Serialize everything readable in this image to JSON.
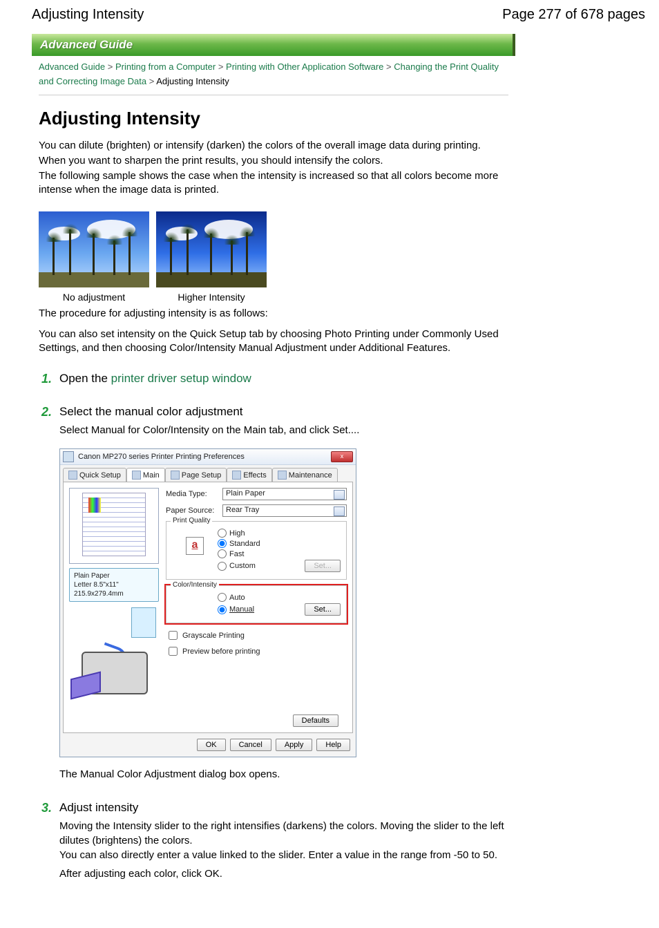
{
  "header": {
    "title": "Adjusting Intensity",
    "page_info": "Page 277 of 678 pages"
  },
  "banner": "Advanced Guide",
  "breadcrumb": {
    "l1": "Advanced Guide",
    "l2": "Printing from a Computer",
    "l3": "Printing with Other Application Software",
    "l4": "Changing the Print Quality and Correcting Image Data",
    "current": "Adjusting Intensity",
    "sep": ">"
  },
  "page_title": "Adjusting Intensity",
  "intro": {
    "p1": "You can dilute (brighten) or intensify (darken) the colors of the overall image data during printing.",
    "p2": "When you want to sharpen the print results, you should intensify the colors.",
    "p3": "The following sample shows the case when the intensity is increased so that all colors become more intense when the image data is printed."
  },
  "samples": {
    "cap1": "No adjustment",
    "cap2": "Higher Intensity"
  },
  "after_samples": {
    "p1": "The procedure for adjusting intensity is as follows:",
    "p2": "You can also set intensity on the Quick Setup tab by choosing Photo Printing under Commonly Used Settings, and then choosing Color/Intensity Manual Adjustment under Additional Features."
  },
  "steps": {
    "n1": "1.",
    "n2": "2.",
    "n3": "3.",
    "s1_pre": "Open the ",
    "s1_link": "printer driver setup window",
    "s2_head": "Select the manual color adjustment",
    "s2_body": "Select Manual for Color/Intensity on the Main tab, and click Set....",
    "s2_after": "The Manual Color Adjustment dialog box opens.",
    "s3_head": "Adjust intensity",
    "s3_p1": "Moving the Intensity slider to the right intensifies (darkens) the colors. Moving the slider to the left dilutes (brightens) the colors.",
    "s3_p2": "You can also directly enter a value linked to the slider. Enter a value in the range from -50 to 50.",
    "s3_p3": "After adjusting each color, click OK."
  },
  "dialog": {
    "title": "Canon MP270 series Printer Printing Preferences",
    "close": "x",
    "tabs": {
      "quick": "Quick Setup",
      "main": "Main",
      "page": "Page Setup",
      "effects": "Effects",
      "maint": "Maintenance"
    },
    "media_lbl": "Media Type:",
    "media_val": "Plain Paper",
    "source_lbl": "Paper Source:",
    "source_val": "Rear Tray",
    "quality_grp": "Print Quality",
    "q_high": "High",
    "q_std": "Standard",
    "q_fast": "Fast",
    "q_custom": "Custom",
    "q_icon": "a",
    "set_btn": "Set...",
    "color_grp": "Color/Intensity",
    "c_auto": "Auto",
    "c_manual": "Manual",
    "grayscale": "Grayscale Printing",
    "preview": "Preview before printing",
    "info1": "Plain Paper",
    "info2": "Letter 8.5\"x11\" 215.9x279.4mm",
    "defaults": "Defaults",
    "ok": "OK",
    "cancel": "Cancel",
    "apply": "Apply",
    "help": "Help"
  }
}
